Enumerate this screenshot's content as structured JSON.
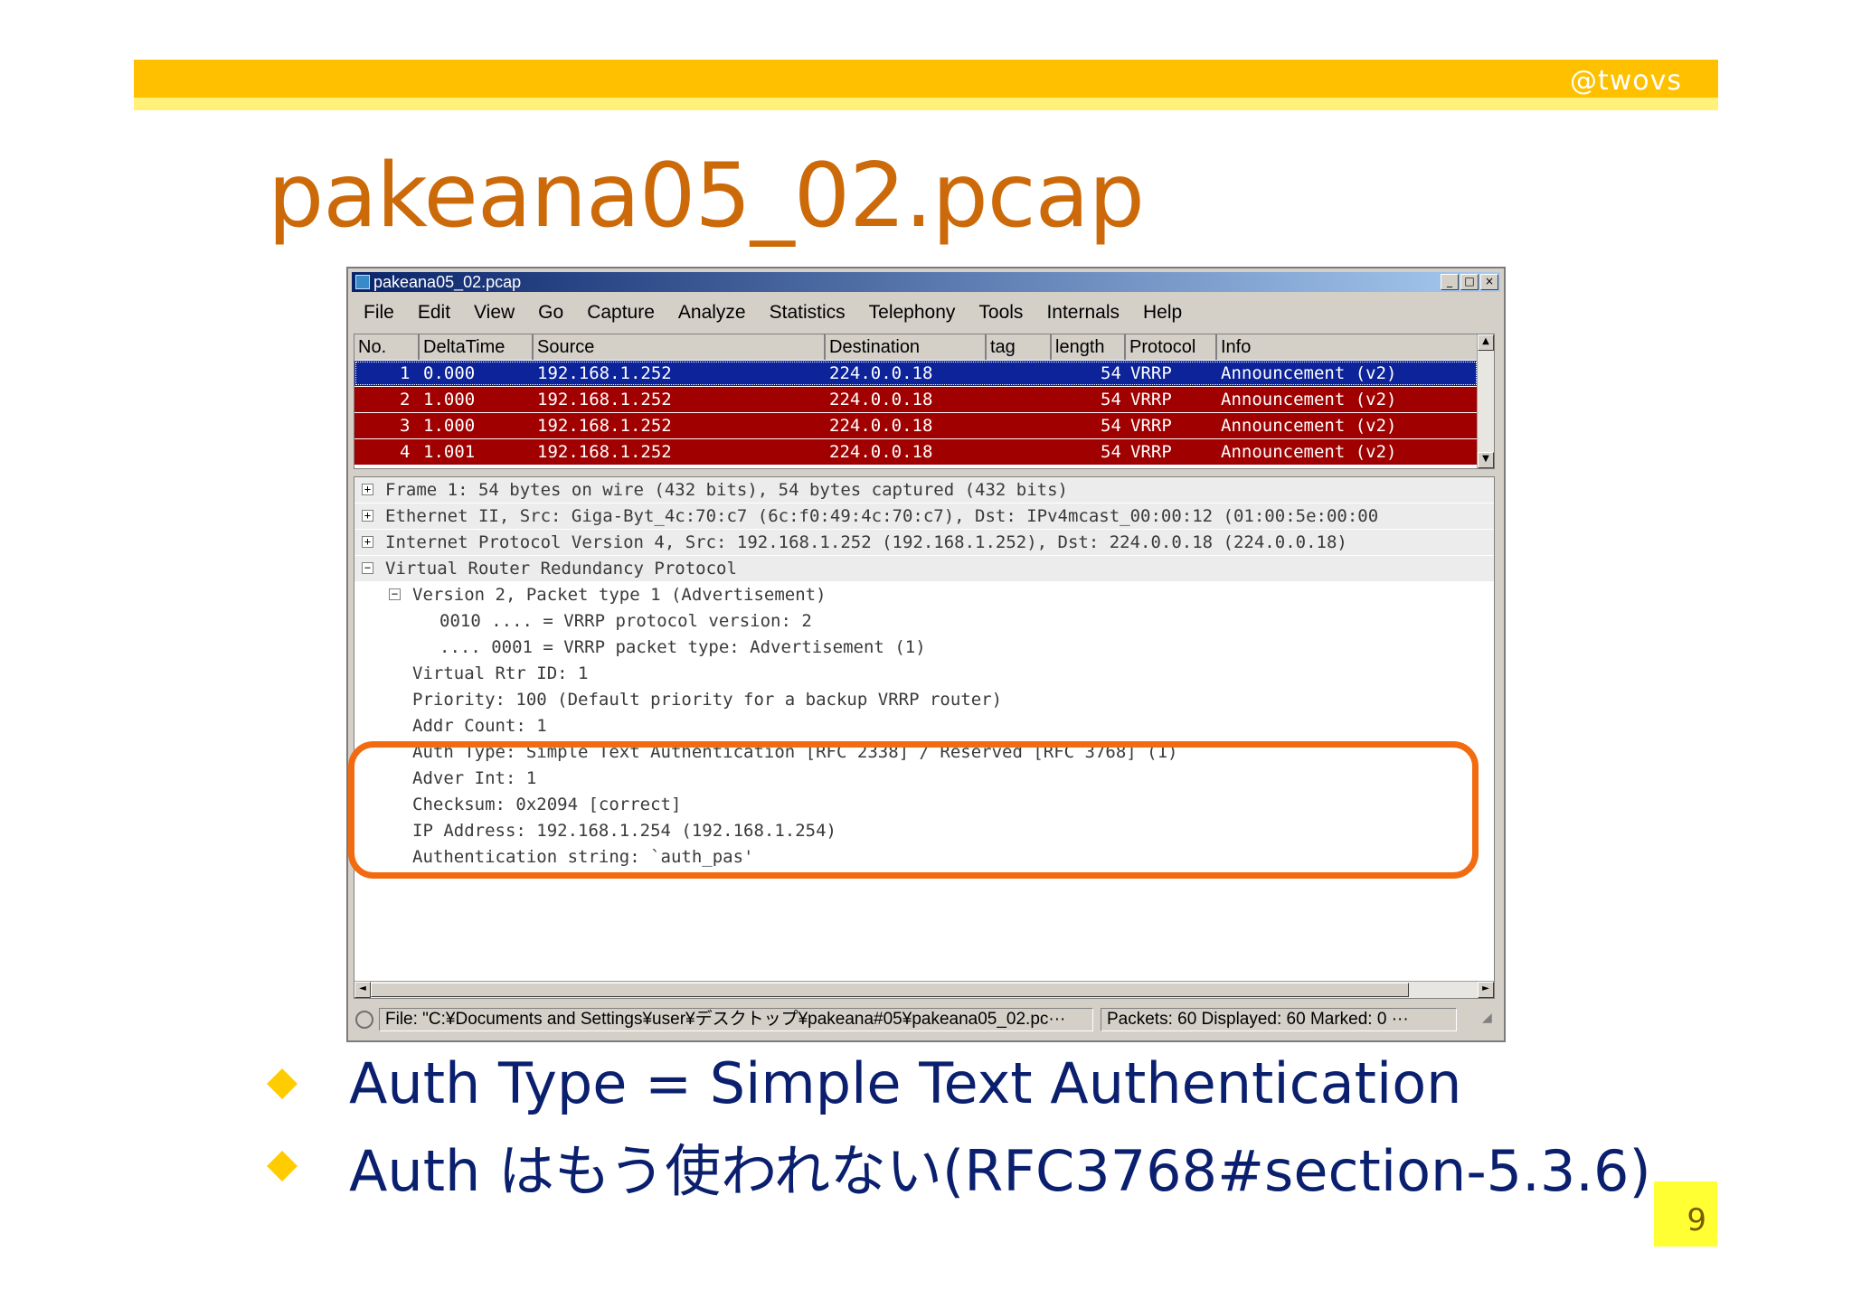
{
  "slide": {
    "handle": "@twovs",
    "title": "pakeana05_02.pcap",
    "page_number": "9",
    "bullets": [
      "Auth Type = Simple Text Authentication",
      "Auth はもう使われない(RFC3768#section-5.3.6)"
    ],
    "colors": {
      "top_bar": "#ffc000",
      "title": "#cc6a0a",
      "bullet_text": "#0a1f6e",
      "highlight_box": "#f26b10"
    }
  },
  "window": {
    "title": "pakeana05_02.pcap",
    "buttons": [
      "minimize-icon",
      "maximize-icon",
      "close-icon"
    ],
    "menu": [
      "File",
      "Edit",
      "View",
      "Go",
      "Capture",
      "Analyze",
      "Statistics",
      "Telephony",
      "Tools",
      "Internals",
      "Help"
    ]
  },
  "packet_list": {
    "columns": [
      "No.",
      "DeltaTime",
      "Source",
      "Destination",
      "tag",
      "length",
      "Protocol",
      "Info"
    ],
    "rows": [
      {
        "no": "1",
        "delta": "0.000",
        "source": "192.168.1.252",
        "destination": "224.0.0.18",
        "tag": "",
        "length": "54",
        "protocol": "VRRP",
        "info": "Announcement (v2)",
        "selected": true
      },
      {
        "no": "2",
        "delta": "1.000",
        "source": "192.168.1.252",
        "destination": "224.0.0.18",
        "tag": "",
        "length": "54",
        "protocol": "VRRP",
        "info": "Announcement (v2)",
        "selected": false
      },
      {
        "no": "3",
        "delta": "1.000",
        "source": "192.168.1.252",
        "destination": "224.0.0.18",
        "tag": "",
        "length": "54",
        "protocol": "VRRP",
        "info": "Announcement (v2)",
        "selected": false
      },
      {
        "no": "4",
        "delta": "1.001",
        "source": "192.168.1.252",
        "destination": "224.0.0.18",
        "tag": "",
        "length": "54",
        "protocol": "VRRP",
        "info": "Announcement (v2)",
        "selected": false
      }
    ],
    "colors": {
      "selected_row": "#0c2399",
      "row": "#a00000"
    }
  },
  "details": {
    "lines": [
      {
        "text": "Frame 1: 54 bytes on wire (432 bits), 54 bytes captured (432 bits)",
        "toggle": "+",
        "level": 0
      },
      {
        "text": "Ethernet II, Src: Giga-Byt_4c:70:c7 (6c:f0:49:4c:70:c7), Dst: IPv4mcast_00:00:12 (01:00:5e:00:00",
        "toggle": "+",
        "level": 0
      },
      {
        "text": "Internet Protocol Version 4, Src: 192.168.1.252 (192.168.1.252), Dst: 224.0.0.18 (224.0.0.18)",
        "toggle": "+",
        "level": 0
      },
      {
        "text": "Virtual Router Redundancy Protocol",
        "toggle": "-",
        "level": 0
      },
      {
        "text": "Version 2, Packet type 1 (Advertisement)",
        "toggle": "-",
        "level": 1
      },
      {
        "text": "0010 .... = VRRP protocol version: 2",
        "toggle": "",
        "level": 2
      },
      {
        "text": ".... 0001 = VRRP packet type: Advertisement (1)",
        "toggle": "",
        "level": 2
      },
      {
        "text": "Virtual Rtr ID: 1",
        "toggle": "",
        "level": 1
      },
      {
        "text": "Priority: 100 (Default priority for a backup VRRP router)",
        "toggle": "",
        "level": 1
      },
      {
        "text": "Addr Count: 1",
        "toggle": "",
        "level": 1
      },
      {
        "text": "Auth Type: Simple Text Authentication [RFC 2338] / Reserved [RFC 3768] (1)",
        "toggle": "",
        "level": 1
      },
      {
        "text": "Adver Int: 1",
        "toggle": "",
        "level": 1
      },
      {
        "text": "Checksum: 0x2094 [correct]",
        "toggle": "",
        "level": 1
      },
      {
        "text": "IP Address: 192.168.1.254 (192.168.1.254)",
        "toggle": "",
        "level": 1
      },
      {
        "text": "Authentication string: `auth_pas'",
        "toggle": "",
        "level": 1
      }
    ]
  },
  "status_bar": {
    "file": "File: \"C:¥Documents and Settings¥user¥デスクトップ¥pakeana#05¥pakeana05_02.pc···",
    "packets": "Packets: 60 Displayed: 60 Marked: 0 ···"
  }
}
